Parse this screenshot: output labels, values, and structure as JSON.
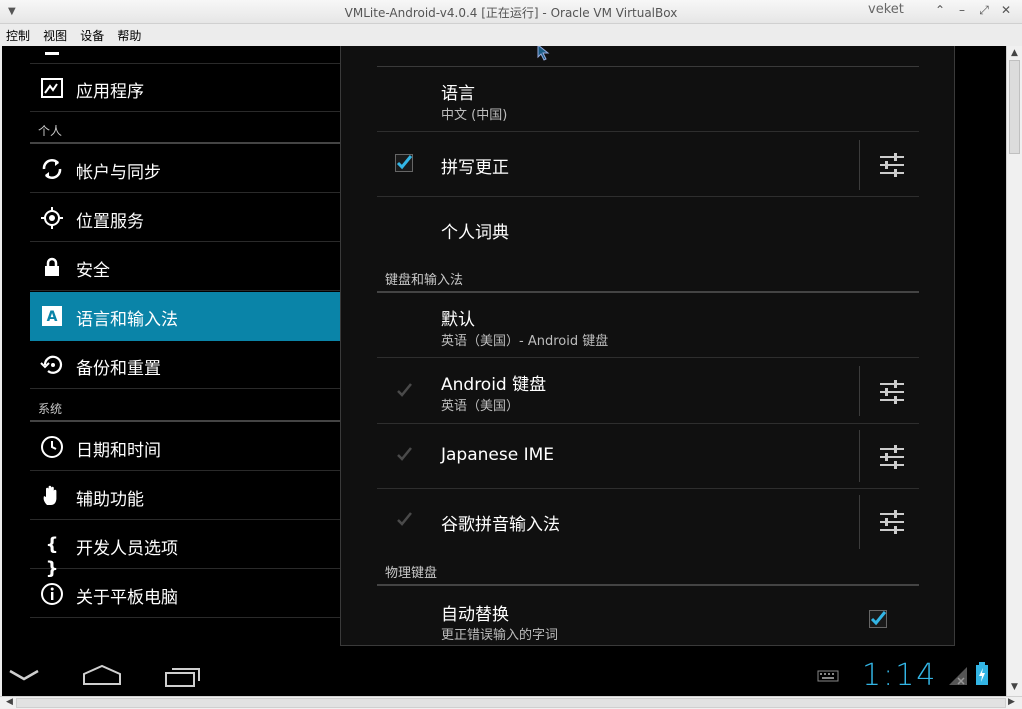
{
  "window": {
    "title": "VMLite-Android-v4.0.4 [正在运行] - Oracle VM VirtualBox",
    "user": "veket",
    "controls": [
      "⌃",
      "–",
      "⤢",
      "✕"
    ]
  },
  "menubar": [
    "控制",
    "视图",
    "设备",
    "帮助"
  ],
  "left_panel": {
    "items": [
      {
        "label": "应用程序",
        "icon": "apps-icon"
      },
      {
        "label": "帐户与同步",
        "icon": "sync-icon"
      },
      {
        "label": "位置服务",
        "icon": "location-icon"
      },
      {
        "label": "安全",
        "icon": "lock-icon"
      },
      {
        "label": "语言和输入法",
        "icon": "keyboard-a-icon",
        "active": true
      },
      {
        "label": "备份和重置",
        "icon": "backup-restore-icon"
      },
      {
        "label": "日期和时间",
        "icon": "clock-icon"
      },
      {
        "label": "辅助功能",
        "icon": "hand-icon"
      },
      {
        "label": "开发人员选项",
        "icon": "braces-icon"
      },
      {
        "label": "关于平板电脑",
        "icon": "info-icon"
      }
    ],
    "sections": {
      "personal": "个人",
      "system": "系统"
    }
  },
  "right_panel": {
    "language": {
      "title": "语言",
      "value": "中文 (中国)"
    },
    "spell": {
      "title": "拼写更正",
      "checked": true
    },
    "dictionary": {
      "title": "个人词典"
    },
    "section_keyboard": "键盘和输入法",
    "default": {
      "title": "默认",
      "value": "英语（美国）- Android 键盘"
    },
    "android_kb": {
      "title": "Android 键盘",
      "value": "英语（美国）",
      "checked": true
    },
    "japanese": {
      "title": "Japanese IME",
      "checked": true
    },
    "pinyin": {
      "title": "谷歌拼音输入法",
      "checked": true
    },
    "section_physical": "物理键盘",
    "autoreplace": {
      "title": "自动替换",
      "value": "更正错误输入的字词",
      "checked": true
    }
  },
  "statusbar": {
    "time": "1:14"
  },
  "colors": {
    "accent": "#33b5e5",
    "active_row": "#0a84a8"
  }
}
